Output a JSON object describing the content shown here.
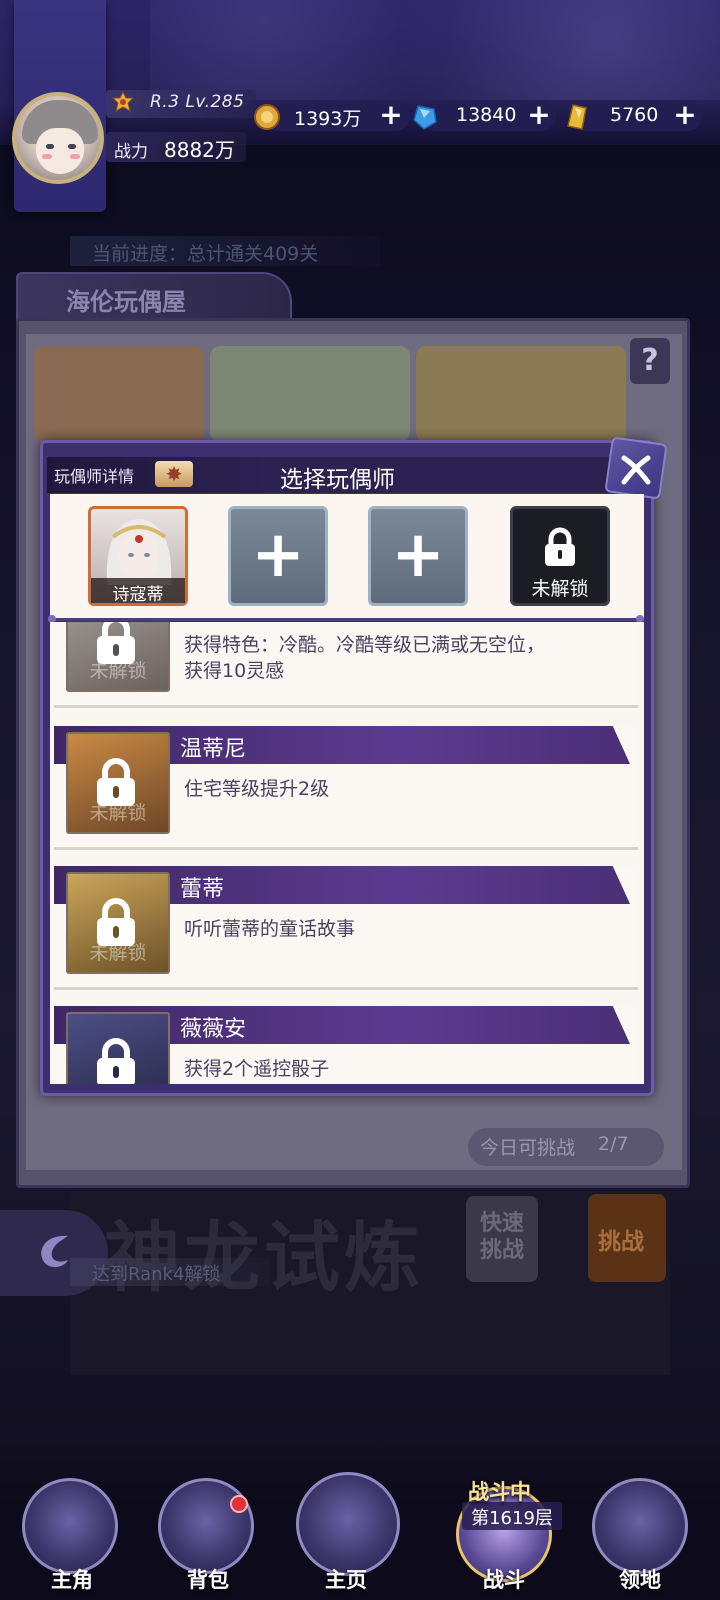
{
  "player": {
    "rank_level": "R.3 Lv.285",
    "power_label": "战力",
    "power_value": "8882万"
  },
  "resources": [
    {
      "icon": "gold-coin-icon",
      "value": "1393万"
    },
    {
      "icon": "blue-diamond-icon",
      "value": "13840"
    },
    {
      "icon": "gold-gem-icon",
      "value": "5760"
    }
  ],
  "background_page": {
    "progress_text": "当前进度：总计通关409关",
    "house_title": "海伦玩偶屋",
    "attempts_label": "今日可挑战",
    "attempts_value": "2/7",
    "dragon_title": "神龙试炼",
    "quick_challenge": "快速挑战",
    "challenge": "挑战",
    "unlock_hint": "达到Rank4解锁"
  },
  "modal": {
    "details_label": "玩偶师详情",
    "title": "选择玩偶师",
    "slots": [
      {
        "type": "filled",
        "name": "诗寇蒂"
      },
      {
        "type": "add"
      },
      {
        "type": "add"
      },
      {
        "type": "locked",
        "label": "未解锁"
      }
    ],
    "list": [
      {
        "name": "",
        "desc_line1": "获得特色：冷酷。冷酷等级已满或无空位，",
        "desc_line2": "获得10灵感",
        "lock_label": "未解锁"
      },
      {
        "name": "温蒂尼",
        "desc_line1": "住宅等级提升2级",
        "desc_line2": "",
        "lock_label": "未解锁"
      },
      {
        "name": "蕾蒂",
        "desc_line1": "听听蕾蒂的童话故事",
        "desc_line2": "",
        "lock_label": "未解锁"
      },
      {
        "name": "薇薇安",
        "desc_line1": "获得2个遥控骰子",
        "desc_line2": "",
        "lock_label": ""
      }
    ]
  },
  "nav": {
    "items": [
      {
        "label": "主角"
      },
      {
        "label": "背包",
        "has_notification": true
      },
      {
        "label": "主页"
      },
      {
        "label": "战斗",
        "status": "战斗中",
        "floor": "第1619层",
        "active": true
      },
      {
        "label": "领地"
      }
    ]
  },
  "colors": {
    "accent_purple": "#5b3b8f",
    "notification_red": "#e0323a",
    "slot_border_orange": "#d06c38"
  }
}
